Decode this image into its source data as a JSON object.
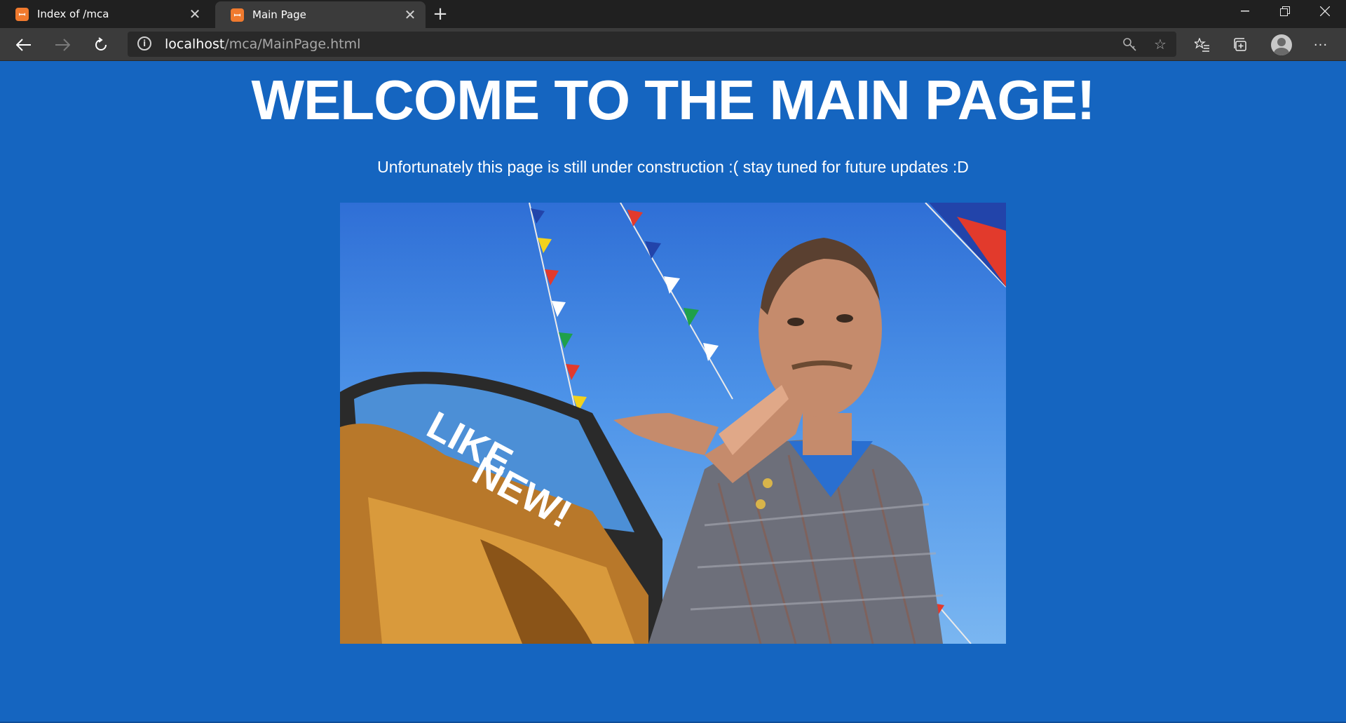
{
  "browser": {
    "tabs": [
      {
        "title": "Index of /mca",
        "icon": "xampp-icon",
        "active": false
      },
      {
        "title": "Main Page",
        "icon": "xampp-icon",
        "active": true
      }
    ],
    "address": {
      "host": "localhost",
      "path": "/mca/MainPage.html"
    }
  },
  "page": {
    "title": "WELCOME TO THE MAIN PAGE!",
    "subtitle": "Unfortunately this page is still under construction :( stay tuned for future updates :D",
    "image": {
      "windshield_text_line1": "LIKE",
      "windshield_text_line2": "NEW!"
    }
  },
  "colors": {
    "page_background": "#1565c0",
    "tabstrip": "#202020",
    "toolbar": "#3b3b3b",
    "favicon": "#f07a2e"
  }
}
